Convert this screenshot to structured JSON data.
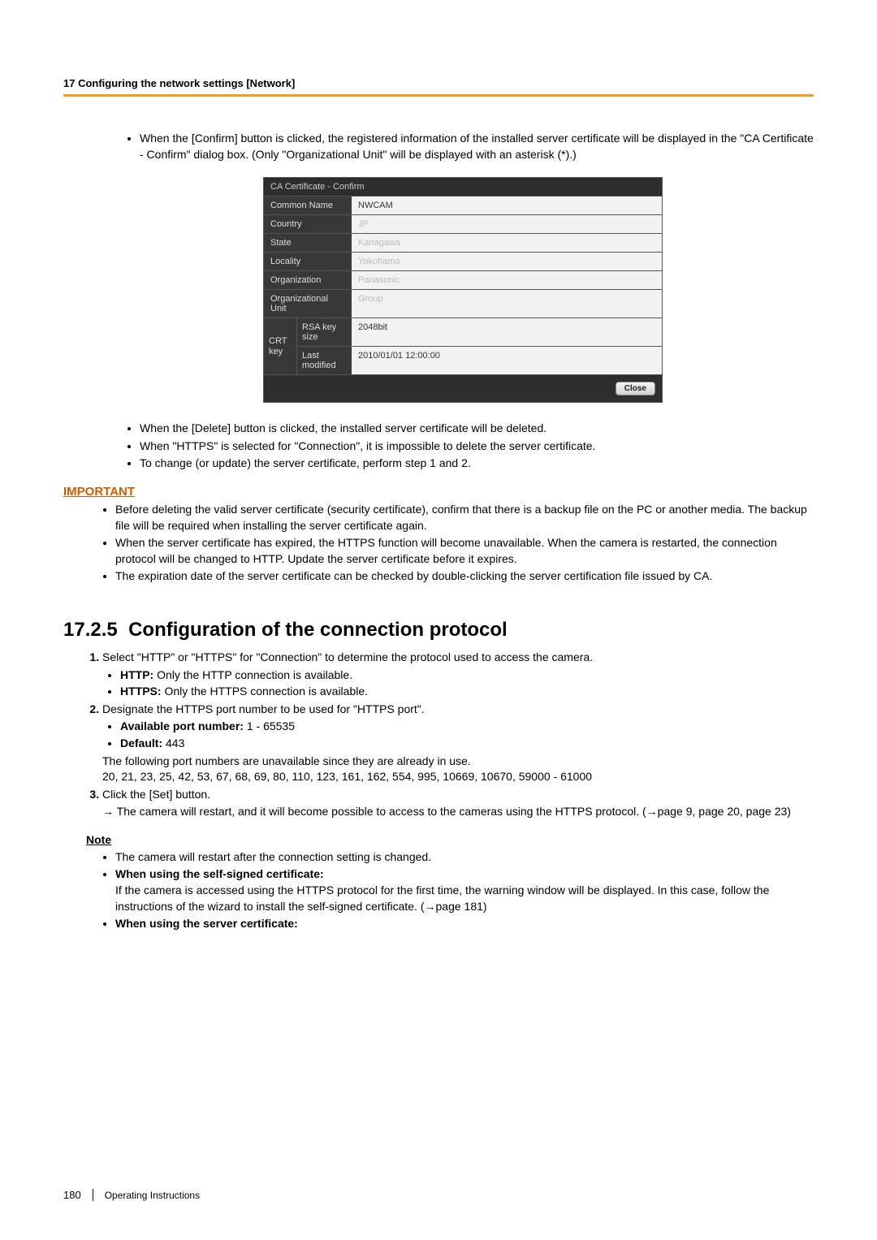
{
  "header": {
    "breadcrumb": "17 Configuring the network settings [Network]"
  },
  "intro": {
    "bullet1": "When the [Confirm] button is clicked, the registered information of the installed server certificate will be displayed in the \"CA Certificate - Confirm\" dialog box. (Only \"Organizational Unit\" will be displayed with an asterisk (*).)"
  },
  "dialog": {
    "title": "CA Certificate - Confirm",
    "rows": {
      "common_name": {
        "label": "Common Name",
        "value": "NWCAM"
      },
      "country": {
        "label": "Country",
        "value": "JP"
      },
      "state": {
        "label": "State",
        "value": "Kanagawa"
      },
      "locality": {
        "label": "Locality",
        "value": "Yokohama"
      },
      "organization": {
        "label": "Organization",
        "value": "Panasonic"
      },
      "org_unit": {
        "label": "Organizational Unit",
        "value": "Group"
      }
    },
    "crt": {
      "label": "CRT key",
      "rsa": {
        "label": "RSA key size",
        "value": "2048bit"
      },
      "last": {
        "label": "Last modified",
        "value": "2010/01/01 12:00:00"
      }
    },
    "close": "Close"
  },
  "post_bullets": {
    "b1": "When the [Delete] button is clicked, the installed server certificate will be deleted.",
    "b2": "When \"HTTPS\" is selected for \"Connection\", it is impossible to delete the server certificate.",
    "b3": "To change (or update) the server certificate, perform step 1 and 2."
  },
  "important": {
    "heading": "IMPORTANT",
    "b1": "Before deleting the valid server certificate (security certificate), confirm that there is a backup file on the PC or another media. The backup file will be required when installing the server certificate again.",
    "b2": "When the server certificate has expired, the HTTPS function will become unavailable. When the camera is restarted, the connection protocol will be changed to HTTP. Update the server certificate before it expires.",
    "b3": "The expiration date of the server certificate can be checked by double-clicking the server certification file issued by CA."
  },
  "section": {
    "number": "17.2.5",
    "title": "Configuration of the connection protocol"
  },
  "steps": {
    "s1": {
      "text": "Select \"HTTP\" or \"HTTPS\" for \"Connection\" to determine the protocol used to access the camera.",
      "http_label": "HTTP:",
      "http_text": " Only the HTTP connection is available.",
      "https_label": "HTTPS:",
      "https_text": " Only the HTTPS connection is available."
    },
    "s2": {
      "text": "Designate the HTTPS port number to be used for \"HTTPS port\".",
      "port_label": "Available port number:",
      "port_text": " 1 - 65535",
      "default_label": "Default:",
      "default_text": " 443",
      "unavail1": "The following port numbers are unavailable since they are already in use.",
      "unavail2": "20, 21, 23, 25, 42, 53, 67, 68, 69, 80, 110, 123, 161, 162, 554, 995, 10669, 10670, 59000 - 61000"
    },
    "s3": {
      "text": "Click the [Set] button.",
      "arrow": "→  The camera will restart, and it will become possible to access to the cameras using the HTTPS protocol. (→page 9, page 20, page 23)"
    }
  },
  "note": {
    "heading": "Note",
    "b1": "The camera will restart after the connection setting is changed.",
    "b2_label": "When using the self-signed certificate:",
    "b2_text": "If the camera is accessed using the HTTPS protocol for the first time, the warning window will be displayed. In this case, follow the instructions of the wizard to install the self-signed certificate. (→page 181)",
    "b3_label": "When using the server certificate:"
  },
  "footer": {
    "page": "180",
    "label": "Operating Instructions"
  }
}
